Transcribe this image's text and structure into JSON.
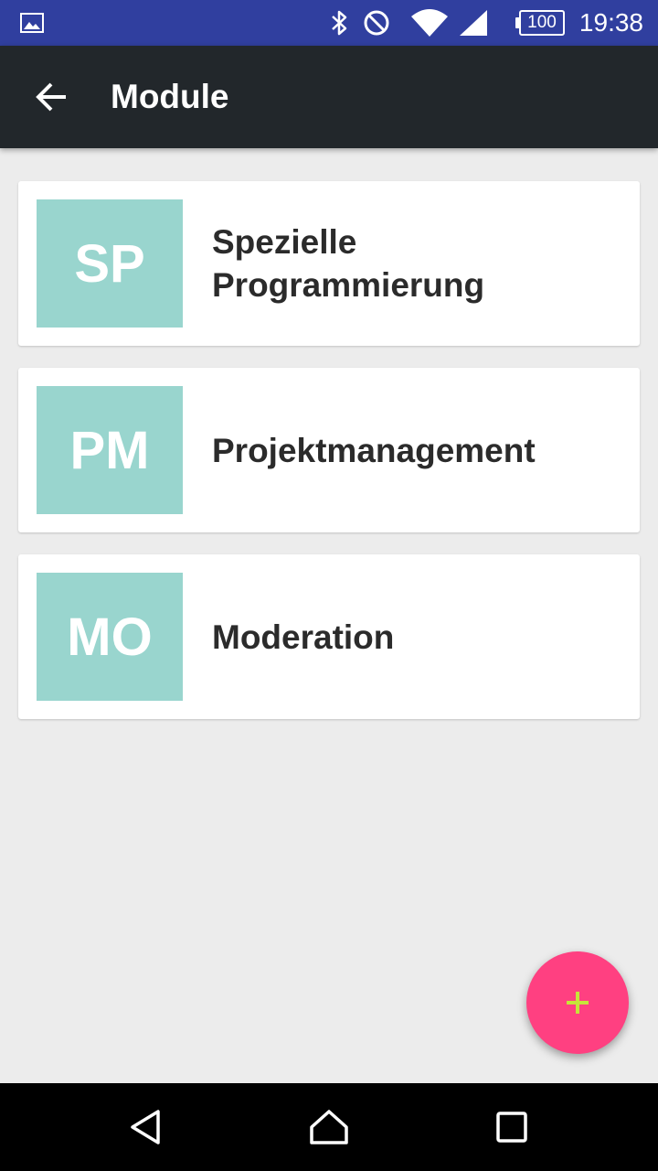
{
  "status_bar": {
    "time": "19:38",
    "battery": "100",
    "icons": [
      "image-notification-icon",
      "bluetooth-icon",
      "do-not-disturb-icon",
      "wifi-icon",
      "cell-signal-icon",
      "battery-icon"
    ]
  },
  "app_bar": {
    "title": "Module",
    "back_icon": "arrow-back-icon"
  },
  "modules": [
    {
      "abbr": "SP",
      "title": "Spezielle Programmierung"
    },
    {
      "abbr": "PM",
      "title": "Projektmanagement"
    },
    {
      "abbr": "MO",
      "title": "Moderation"
    }
  ],
  "fab": {
    "icon": "plus-icon"
  },
  "nav_bar": {
    "icons": [
      "back-triangle-icon",
      "home-icon",
      "recents-icon"
    ]
  },
  "colors": {
    "status_bar": "#303f9f",
    "app_bar": "#22272b",
    "avatar": "#99d5ce",
    "fab": "#ff4081",
    "fab_icon": "#c6e53a",
    "background": "#ececec"
  }
}
